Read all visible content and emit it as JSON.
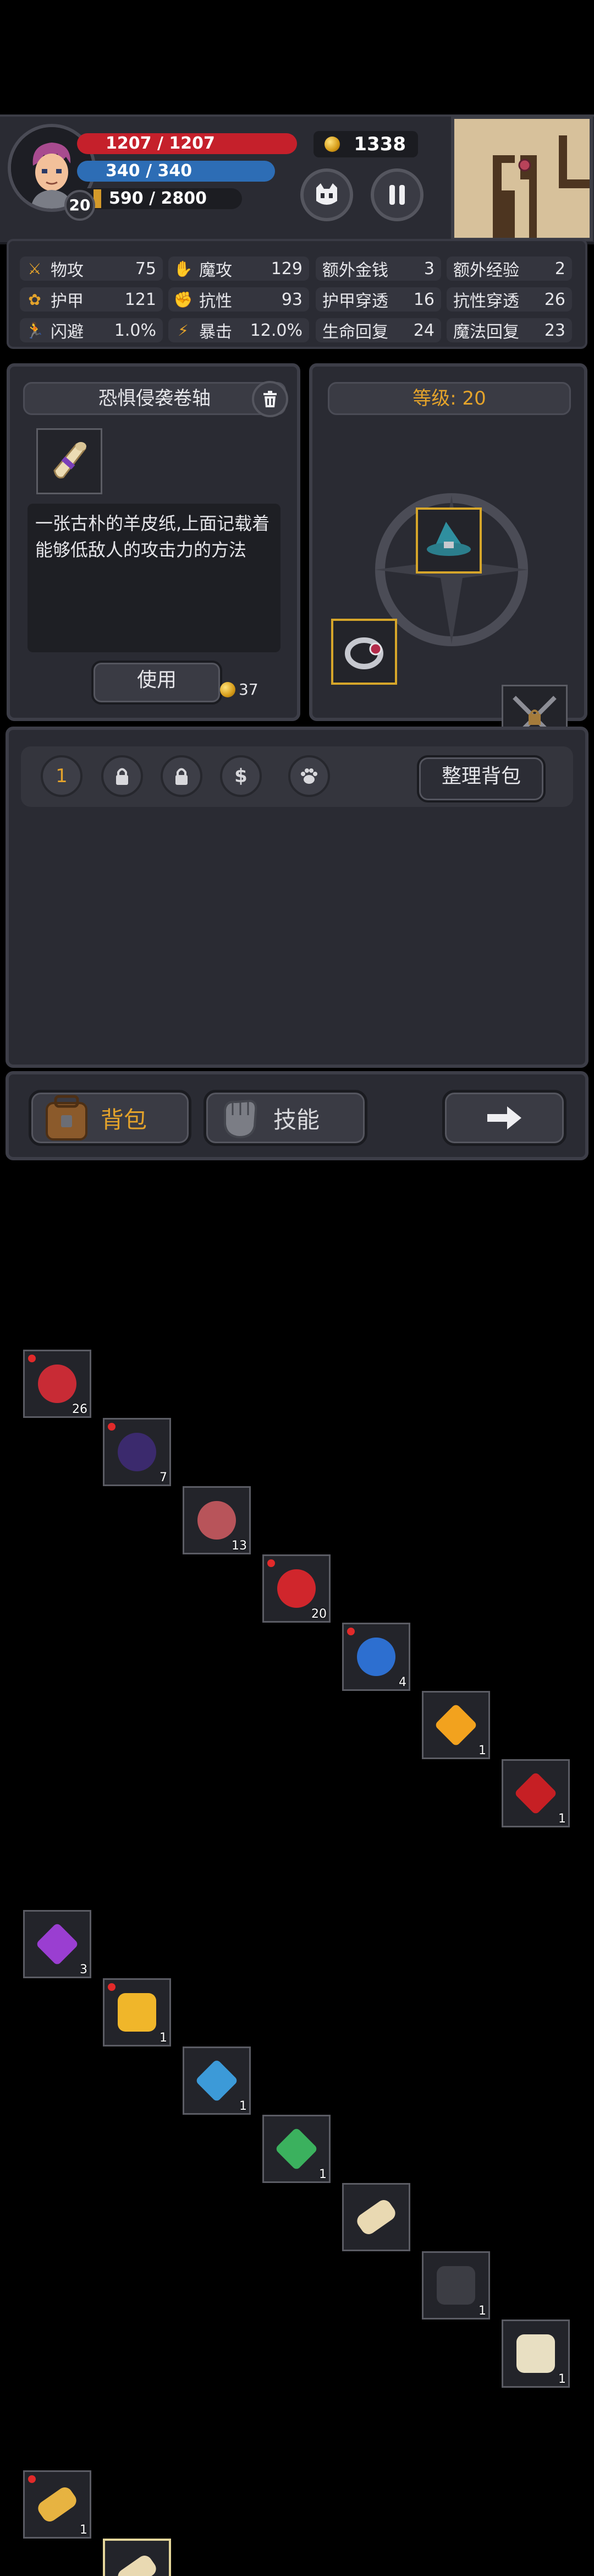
{
  "hud": {
    "hp": "1207 / 1207",
    "mp": "340 / 340",
    "xp": "590 / 2800",
    "level": "20",
    "gold": "1338",
    "pet_icon": "creature-face-icon",
    "pause_icon": "pause-icon"
  },
  "stats": [
    {
      "icon": "sword-icon",
      "label": "物攻",
      "value": "75"
    },
    {
      "icon": "magic-hand-icon",
      "label": "魔攻",
      "value": "129"
    },
    {
      "icon": "coin-icon",
      "label": "额外金钱",
      "value": "3"
    },
    {
      "icon": "xp-icon",
      "label": "额外经验",
      "value": "2"
    },
    {
      "icon": "paw-icon",
      "label": "护甲",
      "value": "121"
    },
    {
      "icon": "muscle-icon",
      "label": "抗性",
      "value": "93"
    },
    {
      "icon": "armor-pen-icon",
      "label": "护甲穿透",
      "value": "16"
    },
    {
      "icon": "resist-pen-icon",
      "label": "抗性穿透",
      "value": "26"
    },
    {
      "icon": "dodge-runner-icon",
      "label": "闪避",
      "value": "1.0%"
    },
    {
      "icon": "lightning-icon",
      "label": "暴击",
      "value": "12.0%"
    },
    {
      "icon": "hp-regen-icon",
      "label": "生命回复",
      "value": "24"
    },
    {
      "icon": "mp-regen-icon",
      "label": "魔法回复",
      "value": "23"
    }
  ],
  "item_panel": {
    "title": "恐惧侵袭卷轴",
    "description": "一张古朴的羊皮纸,上面记载着能够低敌人的攻击力的方法",
    "use_label": "使用",
    "price": "37"
  },
  "equip_panel": {
    "title": "等级: 20"
  },
  "inventory": {
    "tab_number": "1",
    "dollar": "$",
    "sort_label": "整理背包",
    "items": [
      {
        "name": "red-potion",
        "count": "26",
        "new": true
      },
      {
        "name": "berries",
        "count": "7",
        "new": true
      },
      {
        "name": "raw-meat",
        "count": "13",
        "new": false
      },
      {
        "name": "apple",
        "count": "20",
        "new": true
      },
      {
        "name": "blue-potion",
        "count": "4",
        "new": true
      },
      {
        "name": "amber-crystal",
        "count": "1",
        "new": false
      },
      {
        "name": "ruby",
        "count": "1",
        "new": false
      },
      {
        "name": "purple-gem",
        "count": "3",
        "new": false
      },
      {
        "name": "golden-claws",
        "count": "1",
        "new": true
      },
      {
        "name": "blue-crystal",
        "count": "1",
        "new": false
      },
      {
        "name": "green-crystal",
        "count": "1",
        "new": false
      },
      {
        "name": "blue-scroll",
        "count": "",
        "new": false
      },
      {
        "name": "red-button-device",
        "count": "1",
        "new": false
      },
      {
        "name": "rune-stone",
        "count": "1",
        "new": false
      },
      {
        "name": "yellow-scroll",
        "count": "1",
        "new": true
      },
      {
        "name": "purple-scroll",
        "count": "",
        "new": false
      }
    ]
  },
  "nav": {
    "bag_label": "背包",
    "skill_label": "技能"
  },
  "colors": {
    "accent_gold": "#e4a32b",
    "hp_red": "#c5202b",
    "mp_blue": "#2d6db5"
  }
}
